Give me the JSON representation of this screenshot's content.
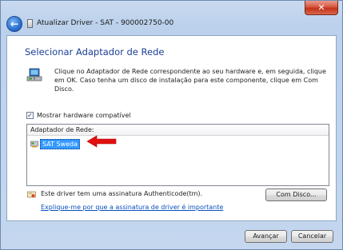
{
  "window": {
    "title": "Atualizar Driver - SAT - 900002750-00",
    "close_label": "✕"
  },
  "dialog": {
    "heading": "Selecionar Adaptador de Rede",
    "description": "Clique no Adaptador de Rede correspondente ao seu hardware e, em seguida, clique em OK. Caso tenha um disco de instalação para este componente, clique em Com Disco.",
    "show_compatible_label": "Mostrar hardware compatível",
    "show_compatible_checked": true,
    "list_header": "Adaptador de Rede:",
    "list_items": [
      "SAT Sweda"
    ],
    "selected_item": "SAT Sweda",
    "signature_text": "Este driver tem uma assinatura Authenticode(tm).",
    "signature_link": "Explique-me por que a assinatura de driver é importante",
    "have_disk_label": "Com Disco..."
  },
  "footer": {
    "next_label": "Avançar",
    "cancel_label": "Cancelar"
  },
  "colors": {
    "heading": "#1b3f96",
    "selection": "#3399ff",
    "arrow": "#e01010",
    "link": "#0a4fbf"
  },
  "icons": {
    "back": "back-arrow-icon",
    "device": "network-adapter-icon",
    "item": "network-card-icon",
    "signature": "certificate-shield-icon",
    "annotation": "red-arrow-icon"
  }
}
